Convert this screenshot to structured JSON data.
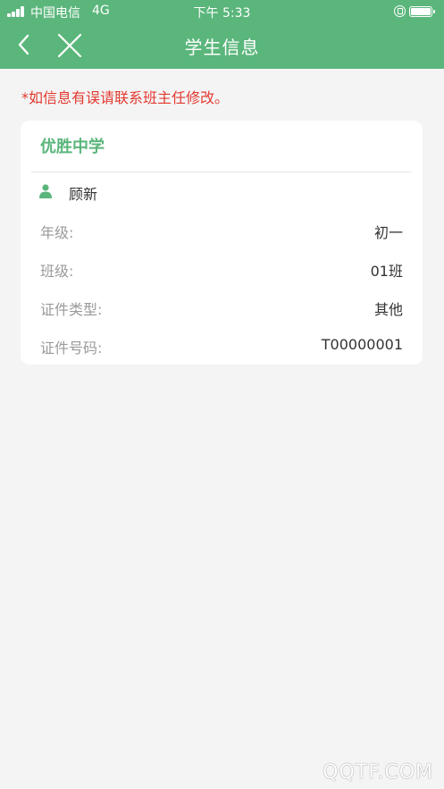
{
  "status_bar": {
    "carrier": "中国电信",
    "network": "4G",
    "time": "下午 5:33"
  },
  "header": {
    "title": "学生信息"
  },
  "notice": "*如信息有误请联系班主任修改。",
  "card": {
    "school": "优胜中学",
    "student_name": "顾新",
    "rows": [
      {
        "label": "年级:",
        "value": "初一"
      },
      {
        "label": "班级:",
        "value": "01班"
      },
      {
        "label": "证件类型:",
        "value": "其他"
      },
      {
        "label": "证件号码:",
        "value": "T00000001"
      }
    ]
  },
  "watermark": "QQTF.COM",
  "colors": {
    "accent": "#5bb67c",
    "notice": "#e23a30",
    "background": "#f4f4f4"
  }
}
